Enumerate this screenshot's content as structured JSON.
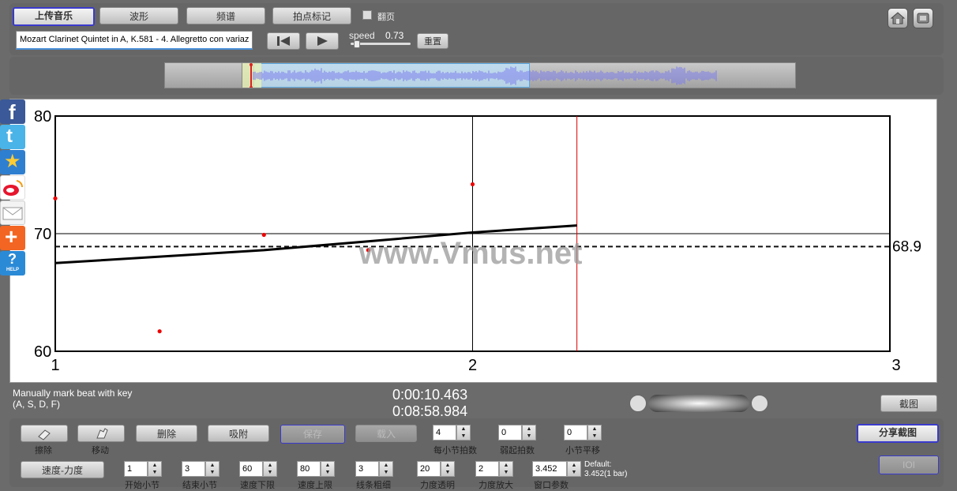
{
  "top": {
    "upload": "上传音乐",
    "waveform": "波形",
    "spectrum": "频谱",
    "beat_mark": "拍点标记",
    "page_turn": "翻页",
    "track_title": "Mozart Clarinet Quintet in A, K.581 - 4. Allegretto con variaz",
    "speed_label": "speed",
    "speed_value": "0.73",
    "reset": "重置"
  },
  "sidebar_icons": [
    "facebook-icon",
    "twitter-icon",
    "star-icon",
    "weibo-icon",
    "mail-icon",
    "plus-icon",
    "help-icon"
  ],
  "help_text": "HELP",
  "chart_data": {
    "type": "line",
    "watermark": "www.Vmus.net",
    "y_ticks": [
      "80",
      "70",
      "60"
    ],
    "x_ticks": [
      "1",
      "2",
      "3"
    ],
    "ylim": [
      60,
      80
    ],
    "xlim": [
      1,
      3
    ],
    "mean_label": "68.9",
    "mean_value": 68.9,
    "trend_line": [
      [
        1.0,
        67.5
      ],
      [
        1.5,
        68.6
      ],
      [
        2.0,
        70.1
      ],
      [
        2.25,
        70.7
      ]
    ],
    "points": [
      [
        1.0,
        73.0
      ],
      [
        1.25,
        61.7
      ],
      [
        1.5,
        69.9
      ],
      [
        1.75,
        68.6
      ],
      [
        2.0,
        74.2
      ]
    ],
    "current_position": 2.25,
    "grid_y": [
      70
    ],
    "grid_x": [
      2
    ]
  },
  "status": {
    "hint_line1": "Manually mark beat with key",
    "hint_line2": "(A, S, D, F)",
    "time_current": "0:00:10.463",
    "time_total": "0:08:58.984",
    "screenshot": "截图"
  },
  "controls": {
    "erase": "擦除",
    "erase_sub": "擦除",
    "move_sub": "移动",
    "delete": "删除",
    "attach": "吸附",
    "save": "保存",
    "load": "载入",
    "beats_per_bar_label": "每小节拍数",
    "beats_per_bar": "4",
    "pickup_label": "弱起拍数",
    "pickup": "0",
    "bar_shift_label": "小节平移",
    "bar_shift": "0",
    "share": "分享截图",
    "tempo_dyn": "速度-力度",
    "start_bar_label": "开始小节",
    "start_bar": "1",
    "end_bar_label": "结束小节",
    "end_bar": "3",
    "tempo_low_label": "速度下限",
    "tempo_low": "60",
    "tempo_high_label": "速度上限",
    "tempo_high": "80",
    "curve_thick_label": "线条粗细",
    "curve_thick": "3",
    "dyn_transp_label": "力度透明",
    "dyn_transp": "20",
    "dyn_scale_label": "力度放大",
    "dyn_scale": "2",
    "window_label": "窗口参数",
    "window_value": "3.452",
    "default_line1": "Default:",
    "default_line2": "3.452(1 bar)",
    "io": "IOI"
  }
}
